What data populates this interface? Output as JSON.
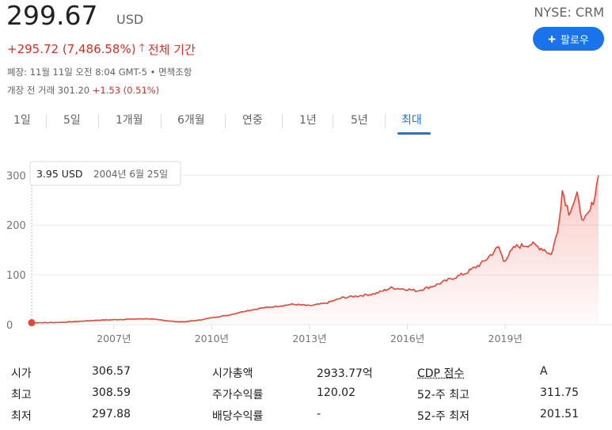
{
  "header": {
    "price": "299.67",
    "currency": "USD",
    "exchange": "NYSE: CRM",
    "follow_label": "팔로우",
    "change_text": "+295.72 (7,486.58%)",
    "change_period": "전체 기간",
    "market_info": "폐장: 11월 11일 오전 8:04 GMT-5 • 면책조항",
    "premarket_prefix": "개장 전 거래 301.20",
    "premarket_change": "+1.53 (0.51%)"
  },
  "tabs": [
    {
      "label": "1일",
      "active": false
    },
    {
      "label": "5일",
      "active": false
    },
    {
      "label": "1개월",
      "active": false
    },
    {
      "label": "6개월",
      "active": false
    },
    {
      "label": "연중",
      "active": false
    },
    {
      "label": "1년",
      "active": false
    },
    {
      "label": "5년",
      "active": false
    },
    {
      "label": "최대",
      "active": true
    }
  ],
  "tooltip": {
    "value": "3.95 USD",
    "date": "2004년 6월 25일"
  },
  "chart_data": {
    "type": "area",
    "line_color": "#ea4335",
    "ylim": [
      0,
      310
    ],
    "y_ticks": [
      0,
      100,
      200,
      300
    ],
    "y_tick_labels": [
      "0",
      "100",
      "200",
      "300"
    ],
    "x_range": [
      2004.48,
      2021.86
    ],
    "x_ticks": [
      2007,
      2010,
      2013,
      2016,
      2019
    ],
    "x_tick_labels": [
      "2007년",
      "2010년",
      "2013년",
      "2016년",
      "2019년"
    ],
    "grid": true,
    "x": [
      2004.48,
      2005.0,
      2005.5,
      2006.0,
      2006.5,
      2007.0,
      2007.5,
      2008.0,
      2008.5,
      2008.9,
      2009.2,
      2009.6,
      2010.0,
      2010.5,
      2011.0,
      2011.5,
      2012.0,
      2012.5,
      2013.0,
      2013.5,
      2014.0,
      2014.5,
      2015.0,
      2015.5,
      2016.0,
      2016.3,
      2016.8,
      2017.3,
      2017.8,
      2018.3,
      2018.8,
      2018.95,
      2019.3,
      2019.8,
      2020.2,
      2020.4,
      2020.6,
      2020.75,
      2020.95,
      2021.2,
      2021.4,
      2021.6,
      2021.75,
      2021.86
    ],
    "y": [
      3.95,
      4,
      5,
      7,
      9,
      10,
      11,
      12,
      9,
      6,
      6,
      9,
      14,
      19,
      27,
      33,
      37,
      41,
      38,
      43,
      54,
      58,
      62,
      74,
      71,
      68,
      78,
      91,
      104,
      124,
      156,
      128,
      156,
      162,
      151,
      140,
      185,
      269,
      226,
      258,
      205,
      228,
      260,
      300
    ]
  },
  "stats": [
    {
      "label": "시가",
      "value": "306.57"
    },
    {
      "label": "최고",
      "value": "308.59"
    },
    {
      "label": "최저",
      "value": "297.88"
    },
    {
      "label": "시가총액",
      "value": "2933.77억"
    },
    {
      "label": "주가수익률",
      "value": "120.02"
    },
    {
      "label": "배당수익률",
      "value": "-"
    },
    {
      "label": "CDP 점수",
      "value": "A"
    },
    {
      "label": "52-주 최고",
      "value": "311.75"
    },
    {
      "label": "52-주 최저",
      "value": "201.51"
    }
  ]
}
